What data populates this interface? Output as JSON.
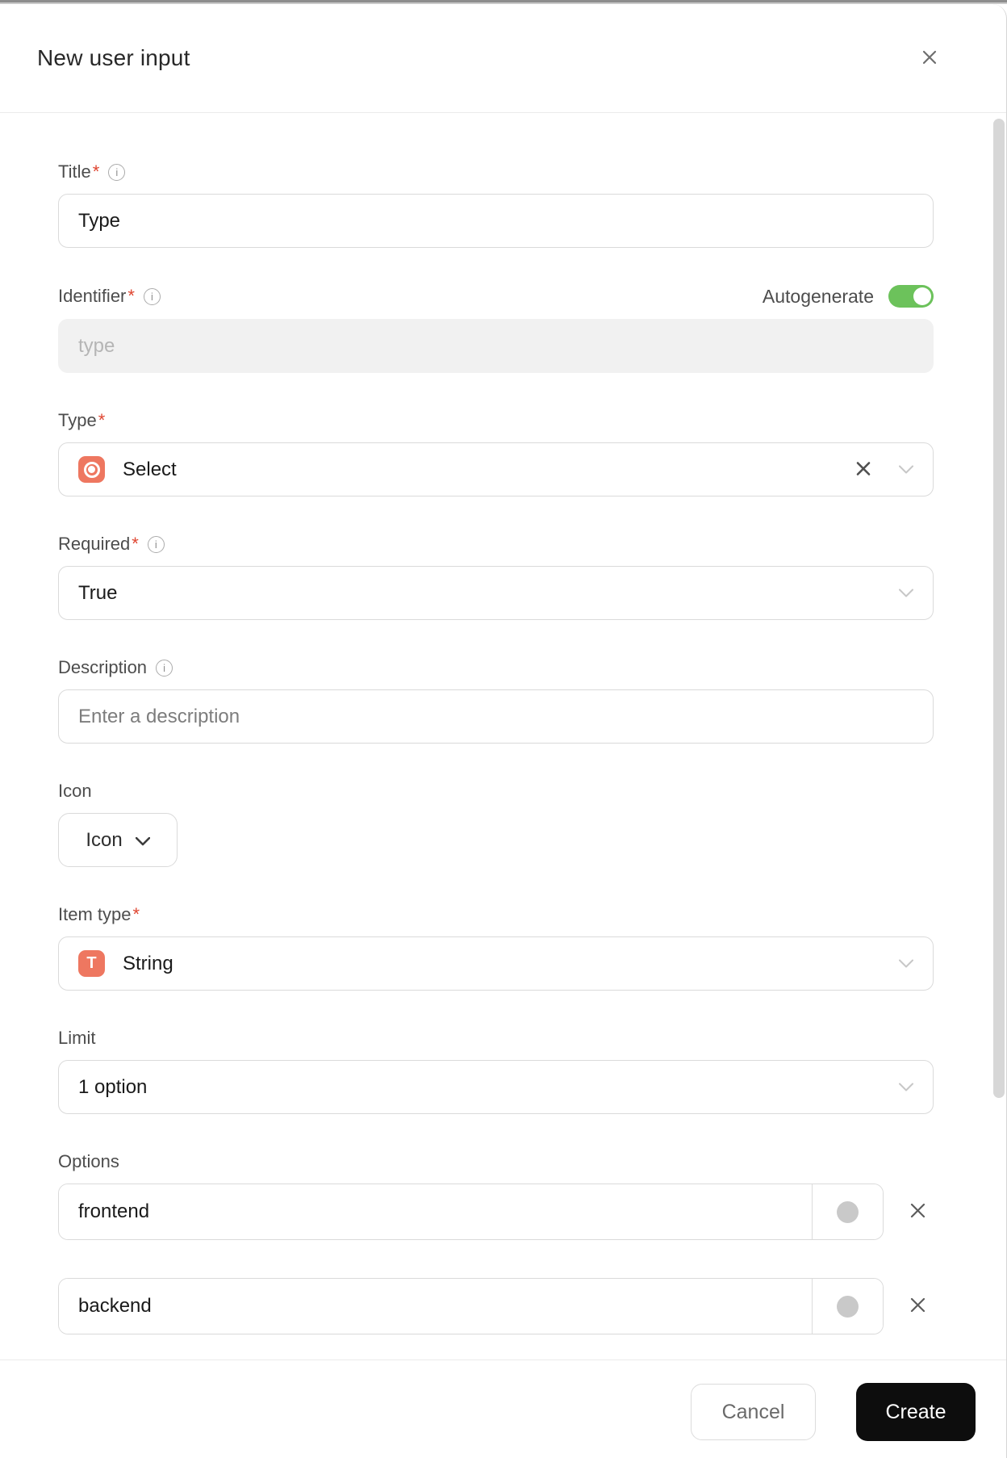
{
  "ui": {
    "required_mark": "*"
  },
  "header": {
    "title": "New user input"
  },
  "fields": {
    "title": {
      "label": "Title",
      "value": "Type"
    },
    "identifier": {
      "label": "Identifier",
      "placeholder": "type",
      "autogenerate_label": "Autogenerate",
      "autogenerate_on": true
    },
    "type": {
      "label": "Type",
      "value": "Select",
      "icon": "select-radio-icon"
    },
    "required": {
      "label": "Required",
      "value": "True"
    },
    "description": {
      "label": "Description",
      "placeholder": "Enter a description"
    },
    "icon": {
      "label": "Icon",
      "button_label": "Icon"
    },
    "item_type": {
      "label": "Item type",
      "value": "String",
      "icon": "string-type-icon",
      "icon_glyph": "T"
    },
    "limit": {
      "label": "Limit",
      "value": "1 option"
    },
    "options": {
      "label": "Options",
      "items": [
        {
          "value": "frontend"
        },
        {
          "value": "backend"
        }
      ]
    }
  },
  "footer": {
    "cancel_label": "Cancel",
    "create_label": "Create"
  },
  "colors": {
    "accent_orange": "#ee7760",
    "toggle_green": "#6cc25b",
    "create_button": "#0d0d0d",
    "required_red": "#df4530",
    "swatch_gray": "#c9c9c9"
  }
}
